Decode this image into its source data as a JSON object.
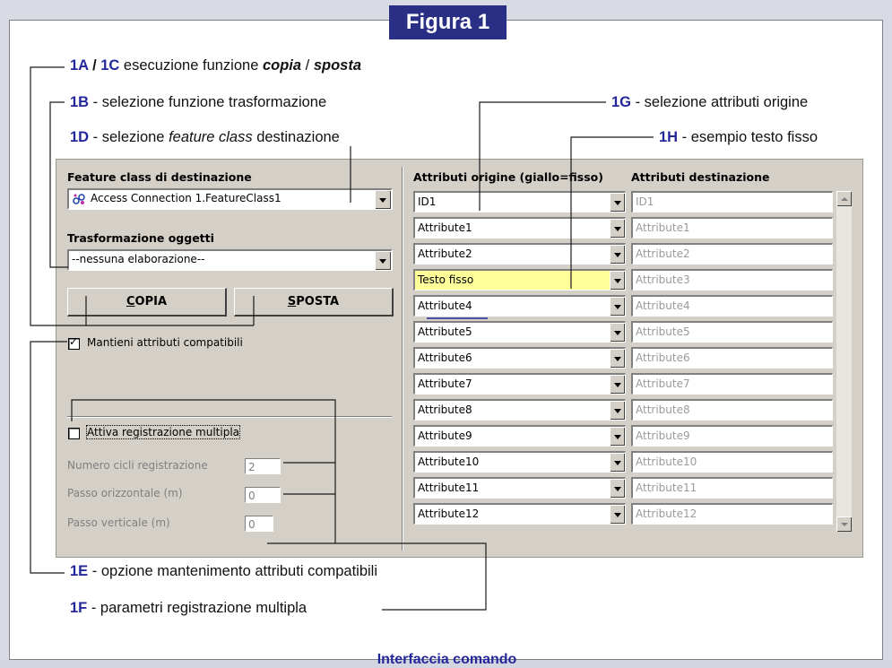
{
  "figure_title": "Figura 1",
  "caption": "Interfaccia comando",
  "annotations": {
    "a1": {
      "key1": "1A",
      "sep": " / ",
      "key2": "1C",
      "text": " esecuzione funzione ",
      "em1": "copia",
      "mid": " / ",
      "em2": "sposta"
    },
    "b": {
      "key": "1B",
      "text": " - selezione funzione trasformazione"
    },
    "d": {
      "key": "1D",
      "text": " - selezione ",
      "em": "feature class",
      "tail": " destinazione"
    },
    "g": {
      "key": "1G",
      "text": " - selezione attributi origine"
    },
    "h": {
      "key": "1H",
      "text": " - esempio testo fisso"
    },
    "e": {
      "key": "1E",
      "text": " - opzione mantenimento attributi compatibili"
    },
    "f": {
      "key": "1F",
      "text": " - parametri registrazione multipla"
    }
  },
  "dialog": {
    "feature_class_label": "Feature class di destinazione",
    "feature_class_value": "Access Connection 1.FeatureClass1",
    "transform_label": "Trasformazione oggetti",
    "transform_value": "--nessuna elaborazione--",
    "copy_button_u": "C",
    "copy_button_rest": "OPIA",
    "move_button_u": "S",
    "move_button_rest": "POSTA",
    "keep_attrs_label": "Mantieni attributi compatibili",
    "keep_attrs_checked": true,
    "multi_label": "Attiva registrazione multipla",
    "multi_checked": false,
    "cycles_label": "Numero cicli registrazione",
    "cycles_value": "2",
    "hstep_label": "Passo orizzontale (m)",
    "hstep_value": "0",
    "vstep_label": "Passo verticale (m)",
    "vstep_value": "0",
    "src_header": "Attributi origine (giallo=fisso)",
    "dst_header": "Attributi destinazione",
    "rows": [
      {
        "src": "ID1",
        "dst": "ID1",
        "fixed": false
      },
      {
        "src": "Attribute1",
        "dst": "Attribute1",
        "fixed": false
      },
      {
        "src": "Attribute2",
        "dst": "Attribute2",
        "fixed": false
      },
      {
        "src": "Testo fisso",
        "dst": "Attribute3",
        "fixed": true
      },
      {
        "src": "Attribute4",
        "dst": "Attribute4",
        "fixed": false
      },
      {
        "src": "Attribute5",
        "dst": "Attribute5",
        "fixed": false
      },
      {
        "src": "Attribute6",
        "dst": "Attribute6",
        "fixed": false
      },
      {
        "src": "Attribute7",
        "dst": "Attribute7",
        "fixed": false
      },
      {
        "src": "Attribute8",
        "dst": "Attribute8",
        "fixed": false
      },
      {
        "src": "Attribute9",
        "dst": "Attribute9",
        "fixed": false
      },
      {
        "src": "Attribute10",
        "dst": "Attribute10",
        "fixed": false
      },
      {
        "src": "Attribute11",
        "dst": "Attribute11",
        "fixed": false
      },
      {
        "src": "Attribute12",
        "dst": "Attribute12",
        "fixed": false
      }
    ]
  },
  "colors": {
    "title_bg": "#2a2f86",
    "key_text": "#23279a",
    "fixed_yellow": "#ffff99",
    "dialog_bg": "#d4d0c8"
  }
}
